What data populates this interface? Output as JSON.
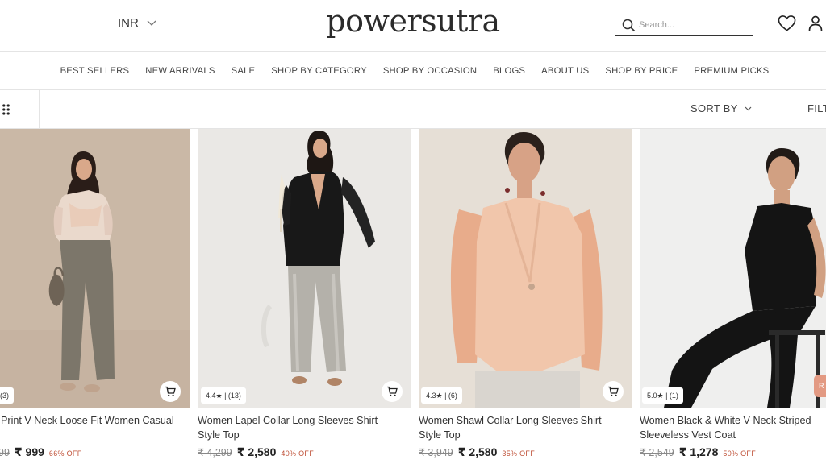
{
  "header": {
    "currency": "INR",
    "logo": "powersutra",
    "search_placeholder": "Search..."
  },
  "nav": {
    "items": [
      "BEST SELLERS",
      "NEW ARRIVALS",
      "SALE",
      "SHOP BY CATEGORY",
      "SHOP BY OCCASION",
      "BLOGS",
      "ABOUT US",
      "SHOP BY PRICE",
      "PREMIUM PICKS"
    ]
  },
  "toolbar": {
    "sort_label": "SORT BY",
    "filter_label": "FILT"
  },
  "products": [
    {
      "title_line1": "Print V-Neck Loose Fit Women Casual",
      "title_line2": "",
      "mrp": "99",
      "price": "₹ 999",
      "discount": "66%  OFF",
      "rating_text": "(3)"
    },
    {
      "title_line1": "Women Lapel Collar Long Sleeves Shirt",
      "title_line2": "Style Top",
      "mrp": "₹ 4,299",
      "price": "₹ 2,580",
      "discount": "40% OFF",
      "rating_text": "4.4★ | (13)"
    },
    {
      "title_line1": "Women Shawl Collar Long Sleeves Shirt",
      "title_line2": "Style Top",
      "mrp": "₹ 3,949",
      "price": "₹ 2,580",
      "discount": "35% OFF",
      "rating_text": "4.3★ | (6)"
    },
    {
      "title_line1": "Women Black & White V-Neck Striped",
      "title_line2": "Sleeveless Vest Coat",
      "mrp": "₹ 2,549",
      "price": "₹ 1,278",
      "discount": "50% OFF",
      "rating_text": "5.0★ | (1)"
    }
  ],
  "peek_button": "R",
  "colors": {
    "discount": "#c0533a",
    "border": "#e4e4e4",
    "peek_button": "#e39a83"
  },
  "icons": [
    "chevron-down-icon",
    "search-icon",
    "heart-icon",
    "user-icon",
    "grid-view-icon",
    "cart-icon"
  ]
}
